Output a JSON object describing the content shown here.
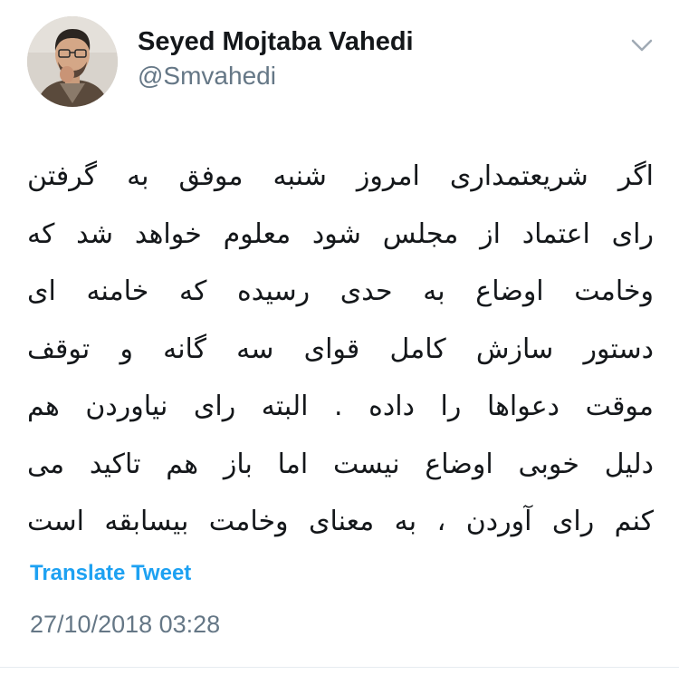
{
  "tweet": {
    "author": {
      "display_name": "Seyed Mojtaba Vahedi",
      "handle": "@Smvahedi"
    },
    "menu_icon": "chevron-down-icon",
    "text_lines": [
      "اگر شریعتمداری امروز شنبه موفق به گرفتن",
      "رای اعتماد از مجلس شود معلوم خواهد شد که",
      "وخامت اوضاع به حدی رسیده که خامنه ای",
      "دستور سازش کامل قوای سه گانه و توقف",
      "موقت دعواها را داده . البته رای نیاوردن هم",
      "دلیل خوبی اوضاع نیست اما باز هم تاکید می",
      "کنم رای آوردن ، به معنای وخامت بیسابقه است"
    ],
    "translate_label": "Translate Tweet",
    "timestamp": "27/10/2018 03:28"
  },
  "colors": {
    "text": "#14171a",
    "secondary": "#657786",
    "link": "#1da1f2",
    "divider": "#e6ecf0"
  }
}
